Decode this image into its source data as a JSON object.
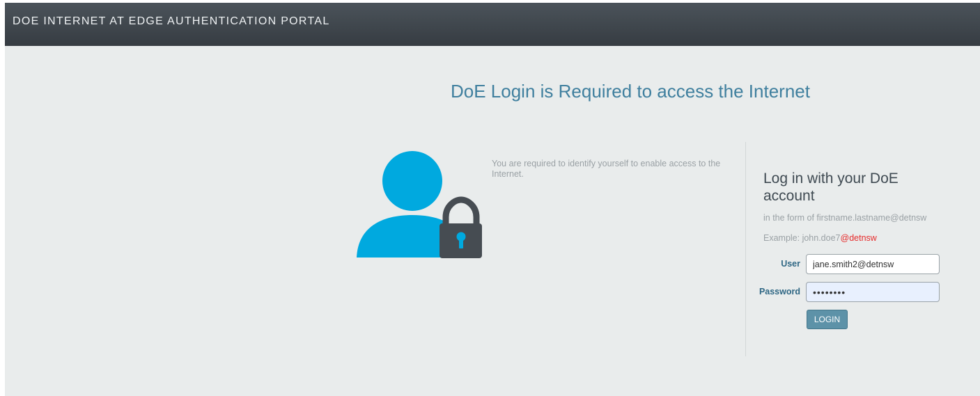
{
  "header": {
    "title": "DOE INTERNET AT EDGE AUTHENTICATION PORTAL"
  },
  "main": {
    "heading": "DoE Login is Required to access the Internet",
    "intro": "You are required to identify yourself to enable access to the Internet."
  },
  "login": {
    "title": "Log in with your DoE account",
    "form_hint": "in the form of firstname.lastname@detnsw",
    "example_prefix": "Example: john.doe7",
    "example_domain": "@detnsw",
    "user_label": "User",
    "user_value": "jane.smith2@detnsw",
    "password_label": "Password",
    "password_value": "password",
    "button_label": "LOGIN"
  },
  "icons": {
    "main": "user-lock-icon"
  },
  "colors": {
    "header_bg": "#3f464c",
    "heading": "#3f7f9e",
    "user_icon": "#00a9df",
    "lock_icon": "#464c52",
    "button_bg": "#5d92a8",
    "example_domain": "#e62b2b"
  }
}
